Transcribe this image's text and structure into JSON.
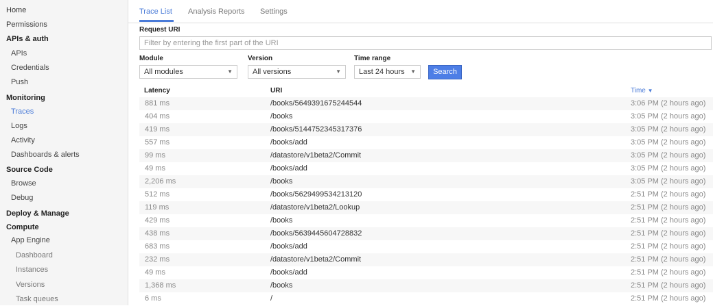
{
  "sidebar": {
    "items": [
      {
        "label": "Home",
        "level": 0
      },
      {
        "label": "Permissions",
        "level": 0
      },
      {
        "label": "APIs & auth",
        "level": 0,
        "section": true
      },
      {
        "label": "APIs",
        "level": 1
      },
      {
        "label": "Credentials",
        "level": 1
      },
      {
        "label": "Push",
        "level": 1
      },
      {
        "label": "Monitoring",
        "level": 0,
        "section": true
      },
      {
        "label": "Traces",
        "level": 1,
        "active": true
      },
      {
        "label": "Logs",
        "level": 1
      },
      {
        "label": "Activity",
        "level": 1
      },
      {
        "label": "Dashboards & alerts",
        "level": 1
      },
      {
        "label": "Source Code",
        "level": 0,
        "section": true
      },
      {
        "label": "Browse",
        "level": 1
      },
      {
        "label": "Debug",
        "level": 1
      },
      {
        "label": "Deploy & Manage",
        "level": 0,
        "section": true
      },
      {
        "label": "Compute",
        "level": 0,
        "section": true
      },
      {
        "label": "App Engine",
        "level": 1
      },
      {
        "label": "Dashboard",
        "level": 2
      },
      {
        "label": "Instances",
        "level": 2
      },
      {
        "label": "Versions",
        "level": 2
      },
      {
        "label": "Task queues",
        "level": 2
      }
    ]
  },
  "tabs": [
    {
      "label": "Trace List",
      "active": true
    },
    {
      "label": "Analysis Reports"
    },
    {
      "label": "Settings"
    }
  ],
  "filters": {
    "request_uri_label": "Request URI",
    "request_uri_placeholder": "Filter by entering the first part of the URI",
    "module_label": "Module",
    "module_value": "All modules",
    "version_label": "Version",
    "version_value": "All versions",
    "time_range_label": "Time range",
    "time_range_value": "Last 24 hours",
    "search_label": "Search"
  },
  "table": {
    "headers": {
      "latency": "Latency",
      "uri": "URI",
      "time": "Time",
      "time_sort_icon": "chevron-down"
    },
    "rows": [
      {
        "latency": "881 ms",
        "uri": "/books/5649391675244544",
        "time": "3:06 PM  (2 hours ago)"
      },
      {
        "latency": "404 ms",
        "uri": "/books",
        "time": "3:05 PM  (2 hours ago)"
      },
      {
        "latency": "419 ms",
        "uri": "/books/5144752345317376",
        "time": "3:05 PM  (2 hours ago)"
      },
      {
        "latency": "557 ms",
        "uri": "/books/add",
        "time": "3:05 PM  (2 hours ago)"
      },
      {
        "latency": "99 ms",
        "uri": "/datastore/v1beta2/Commit",
        "time": "3:05 PM  (2 hours ago)"
      },
      {
        "latency": "49 ms",
        "uri": "/books/add",
        "time": "3:05 PM  (2 hours ago)"
      },
      {
        "latency": "2,206 ms",
        "uri": "/books",
        "time": "3:05 PM  (2 hours ago)"
      },
      {
        "latency": "512 ms",
        "uri": "/books/5629499534213120",
        "time": "2:51 PM  (2 hours ago)"
      },
      {
        "latency": "119 ms",
        "uri": "/datastore/v1beta2/Lookup",
        "time": "2:51 PM  (2 hours ago)"
      },
      {
        "latency": "429 ms",
        "uri": "/books",
        "time": "2:51 PM  (2 hours ago)"
      },
      {
        "latency": "438 ms",
        "uri": "/books/5639445604728832",
        "time": "2:51 PM  (2 hours ago)"
      },
      {
        "latency": "683 ms",
        "uri": "/books/add",
        "time": "2:51 PM  (2 hours ago)"
      },
      {
        "latency": "232 ms",
        "uri": "/datastore/v1beta2/Commit",
        "time": "2:51 PM  (2 hours ago)"
      },
      {
        "latency": "49 ms",
        "uri": "/books/add",
        "time": "2:51 PM  (2 hours ago)"
      },
      {
        "latency": "1,368 ms",
        "uri": "/books",
        "time": "2:51 PM  (2 hours ago)"
      },
      {
        "latency": "6 ms",
        "uri": "/",
        "time": "2:51 PM  (2 hours ago)"
      }
    ]
  },
  "colors": {
    "accent": "#4a7bd8",
    "button": "#4d7ee6",
    "sidebar_bg": "#f5f5f5",
    "row_alt": "#f7f7f7"
  }
}
